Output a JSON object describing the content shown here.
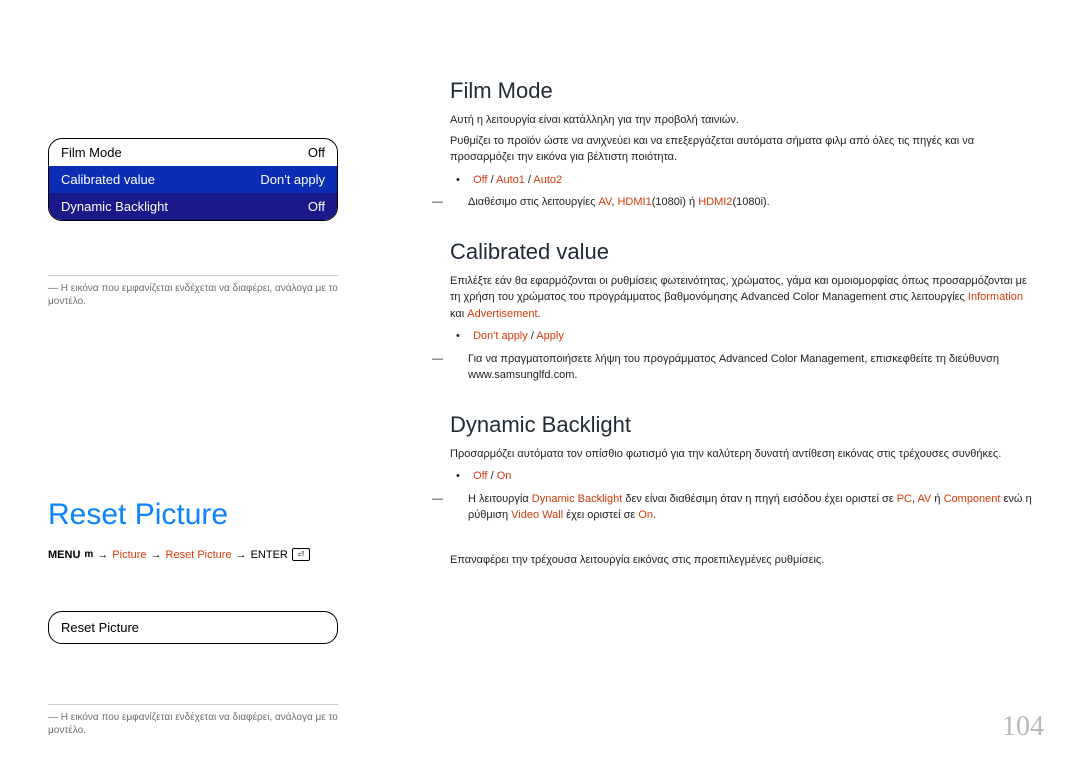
{
  "menu": {
    "rows": [
      {
        "label": "Film Mode",
        "value": "Off"
      },
      {
        "label": "Calibrated value",
        "value": "Don't apply"
      },
      {
        "label": "Dynamic Backlight",
        "value": "Off"
      }
    ]
  },
  "left_disclaimer_prefix": "― ",
  "left_disclaimer": "Η εικόνα που εμφανίζεται ενδέχεται να διαφέρει, ανάλογα με το μοντέλο.",
  "reset_heading": "Reset Picture",
  "breadcrumb": {
    "menu_label": "MENU",
    "menu_glyph": "m",
    "arrow": "→",
    "picture": "Picture",
    "reset_picture": "Reset Picture",
    "enter_label": "ENTER",
    "enter_glyph": "⏎"
  },
  "reset_box_label": "Reset Picture",
  "left_disclaimer2_prefix": "― ",
  "left_disclaimer2": "Η εικόνα που εμφανίζεται ενδέχεται να διαφέρει, ανάλογα με το μοντέλο.",
  "sections": {
    "film_mode": {
      "heading": "Film Mode",
      "p1": "Αυτή η λειτουργία είναι κατάλληλη για την προβολή ταινιών.",
      "p2": "Ρυθμίζει το προϊόν ώστε να ανιχνεύει και να επεξεργάζεται αυτόματα σήματα φιλμ από όλες τις πηγές και να προσαρμόζει την εικόνα για βέλτιστη ποιότητα.",
      "options": {
        "off": "Off",
        "slash": " / ",
        "auto1": "Auto1",
        "auto2": "Auto2"
      },
      "note": {
        "dash": "―",
        "t1": "Διαθέσιμο στις λειτουργίες ",
        "av": "AV",
        "t2": ", ",
        "h1": "HDMI1",
        "h1s": "(1080i)",
        "t3": " ή ",
        "h2": "HDMI2",
        "h2s": "(1080i)."
      }
    },
    "calibrated_value": {
      "heading": "Calibrated value",
      "p1a": "Επιλέξτε εάν θα εφαρμόζονται οι ρυθμίσεις φωτεινότητας, χρώματος, γάμα και ομοιομορφίας όπως προσαρμόζονται με τη χρήση του χρώματος του προγράμματος βαθμονόμησης ",
      "acm": "Advanced Color Management",
      "p1b": " στις λειτουργίες ",
      "info": "Information",
      "and": " και ",
      "advert": "Advertisement",
      "dot": ".",
      "options": {
        "dont": "Don't apply",
        "slash": " / ",
        "apply": "Apply"
      },
      "note": {
        "dash": "―",
        "t1": "Για να πραγματοποιήσετε λήψη του προγράμματος Advanced Color Management, επισκεφθείτε τη διεύθυνση www.samsunglfd.com."
      }
    },
    "dynamic_backlight": {
      "heading": "Dynamic Backlight",
      "p1": "Προσαρμόζει αυτόματα τον οπίσθιο φωτισμό για την καλύτερη δυνατή αντίθεση εικόνας στις τρέχουσες συνθήκες.",
      "options": {
        "off": "Off",
        "slash": " / ",
        "on": "On"
      },
      "note": {
        "dash": "―",
        "t1": "Η λειτουργία ",
        "db": "Dynamic Backlight",
        "t2": " δεν είναι διαθέσιμη όταν η πηγή εισόδου έχει οριστεί σε ",
        "pc": "PC",
        "c1": ", ",
        "av": "AV",
        "t3": " ή ",
        "component": "Component",
        "t4": " ενώ η ρύθμιση ",
        "vw": "Video Wall",
        "t5": " έχει οριστεί σε ",
        "on": "On",
        "dot": "."
      }
    },
    "reset_right": {
      "p1": "Επαναφέρει την τρέχουσα λειτουργία εικόνας στις προεπιλεγμένες ρυθμίσεις."
    }
  },
  "page_number": "104"
}
